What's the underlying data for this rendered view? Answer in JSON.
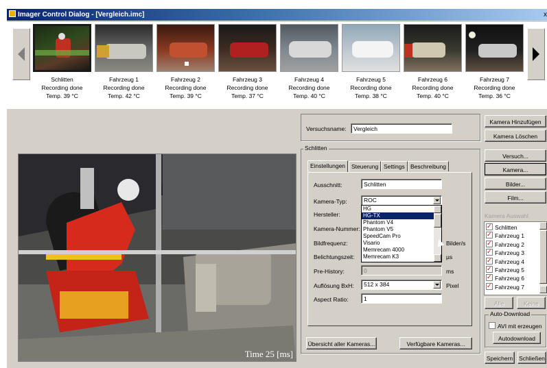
{
  "window": {
    "title": "Imager Control Dialog - [Vergleich.imc]"
  },
  "thumbnails": [
    {
      "name": "Schlitten",
      "status": "Recording done",
      "temp": "Temp. 39 °C"
    },
    {
      "name": "Fahrzeug 1",
      "status": "Recording done",
      "temp": "Temp. 42 °C"
    },
    {
      "name": "Fahrzeug 2",
      "status": "Recording done",
      "temp": "Temp. 39 °C"
    },
    {
      "name": "Fahrzeug 3",
      "status": "Recording done",
      "temp": "Temp. 37 °C"
    },
    {
      "name": "Fahrzeug 4",
      "status": "Recording done",
      "temp": "Temp. 40 °C"
    },
    {
      "name": "Fahrzeug 5",
      "status": "Recording done",
      "temp": "Temp. 38 °C"
    },
    {
      "name": "Fahrzeug 6",
      "status": "Recording done",
      "temp": "Temp. 40 °C"
    },
    {
      "name": "Fahrzeug 7",
      "status": "Recording done",
      "temp": "Temp. 36 °C"
    }
  ],
  "preview": {
    "time_overlay": "Time 25 [ms]"
  },
  "test": {
    "label": "Versuchsname:",
    "value": "Vergleich"
  },
  "group": {
    "title": "Schlitten",
    "tabs": [
      "Einstellungen",
      "Steuerung",
      "Settings",
      "Beschreibung"
    ],
    "fields": {
      "ausschnitt": {
        "label": "Ausschnitt:",
        "value": "Schlitten"
      },
      "kamera_typ": {
        "label": "Kamera-Typ:",
        "value": "ROC"
      },
      "hersteller": {
        "label": "Hersteller:"
      },
      "kamera_nummer": {
        "label": "Kamera-Nummer:"
      },
      "bildfrequenz": {
        "label": "Bildfrequenz:",
        "unit": "Bilder/s"
      },
      "belichtung": {
        "label": "Belichtungszeit:",
        "unit": "µs"
      },
      "prehistory": {
        "label": "Pre-History:",
        "value": "0",
        "unit": "ms"
      },
      "aufloesung": {
        "label": "Auflösung BxH:",
        "value": "512 x 384",
        "unit": "Pixel"
      },
      "aspect": {
        "label": "Aspect Ratio:",
        "value": "1"
      }
    },
    "dropdown_options": [
      "HG",
      "HG-TX",
      "Phantom V4",
      "Phantom V5",
      "SpeedCam Pro",
      "Visario",
      "Memrecam 4000",
      "Memrecam K3"
    ],
    "dropdown_selected": "HG-TX",
    "buttons": {
      "overview": "Übersicht aller Kameras...",
      "available": "Verfügbare Kameras..."
    }
  },
  "right": {
    "add_camera": "Kamera Hinzufügen",
    "delete_camera": "Kamera Löschen",
    "versuch": "Versuch...",
    "kamera": "Kamera...",
    "bilder": "Bilder...",
    "film": "Film...",
    "camera_select_title": "Kamera Auswahl",
    "cameras": [
      "Schlitten",
      "Fahrzeug 1",
      "Fahrzeug 2",
      "Fahrzeug 3",
      "Fahrzeug 4",
      "Fahrzeug 5",
      "Fahrzeug 6",
      "Fahrzeug 7"
    ],
    "alle": "Alle",
    "keine": "Keine",
    "auto_download_title": "Auto-Download",
    "avi_label": "AVI mit erzeugen",
    "autodownload": "Autodownload",
    "speichern": "Speichern",
    "schliessen": "Schließen"
  }
}
